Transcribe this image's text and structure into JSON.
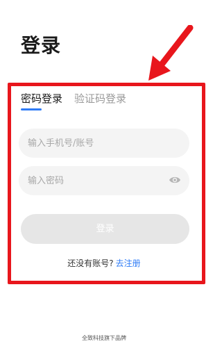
{
  "header": {
    "title": "登录"
  },
  "tabs": [
    {
      "label": "密码登录",
      "active": true
    },
    {
      "label": "验证码登录",
      "active": false
    }
  ],
  "form": {
    "phone_placeholder": "输入手机号/账号",
    "phone_value": "",
    "password_placeholder": "输入密码",
    "password_value": "",
    "password_toggle_icon": "eye-icon",
    "login_label": "登录"
  },
  "register": {
    "prompt": "还没有账号?",
    "link": "去注册"
  },
  "footer": {
    "text": "全致科技旗下品牌"
  },
  "colors": {
    "accent": "#2f7cf6",
    "highlight_annotation": "#e8161c",
    "disabled_button": "#e6e6e6",
    "field_background": "#f4f4f4"
  }
}
